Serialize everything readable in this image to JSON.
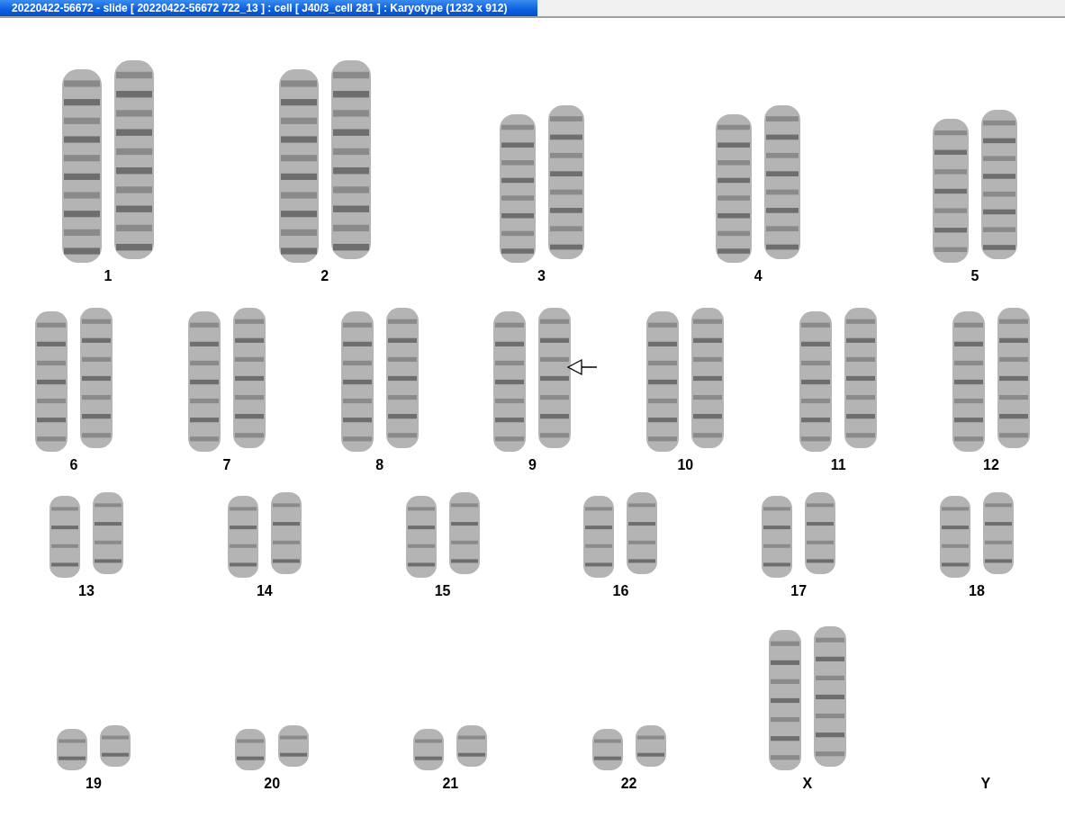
{
  "window": {
    "title": "20220422-56672 - slide [ 20220422-56672 722_13 ] : cell [ J40/3_cell 281 ] : Karyotype  (1232 x 912)"
  },
  "karyotype": {
    "rows": [
      {
        "items": [
          {
            "label": "1",
            "kind": "autosome",
            "marked": false
          },
          {
            "label": "2",
            "kind": "autosome",
            "marked": false
          },
          {
            "label": "3",
            "kind": "autosome",
            "marked": false
          },
          {
            "label": "4",
            "kind": "autosome",
            "marked": false
          },
          {
            "label": "5",
            "kind": "autosome",
            "marked": false
          }
        ]
      },
      {
        "items": [
          {
            "label": "6",
            "kind": "autosome",
            "marked": false
          },
          {
            "label": "7",
            "kind": "autosome",
            "marked": false
          },
          {
            "label": "8",
            "kind": "autosome",
            "marked": false
          },
          {
            "label": "9",
            "kind": "autosome",
            "marked": true
          },
          {
            "label": "10",
            "kind": "autosome",
            "marked": false
          },
          {
            "label": "11",
            "kind": "autosome",
            "marked": false
          },
          {
            "label": "12",
            "kind": "autosome",
            "marked": false
          }
        ]
      },
      {
        "items": [
          {
            "label": "13",
            "kind": "autosome",
            "marked": false
          },
          {
            "label": "14",
            "kind": "autosome",
            "marked": false
          },
          {
            "label": "15",
            "kind": "autosome",
            "marked": false
          },
          {
            "label": "16",
            "kind": "autosome",
            "marked": false
          },
          {
            "label": "17",
            "kind": "autosome",
            "marked": false
          },
          {
            "label": "18",
            "kind": "autosome",
            "marked": false
          }
        ]
      },
      {
        "items": [
          {
            "label": "19",
            "kind": "autosome",
            "marked": false
          },
          {
            "label": "20",
            "kind": "autosome",
            "marked": false
          },
          {
            "label": "21",
            "kind": "autosome",
            "marked": false
          },
          {
            "label": "22",
            "kind": "autosome",
            "marked": false
          },
          {
            "label": "X",
            "kind": "sex",
            "marked": false
          },
          {
            "label": "Y",
            "kind": "empty",
            "marked": false
          }
        ]
      }
    ]
  }
}
